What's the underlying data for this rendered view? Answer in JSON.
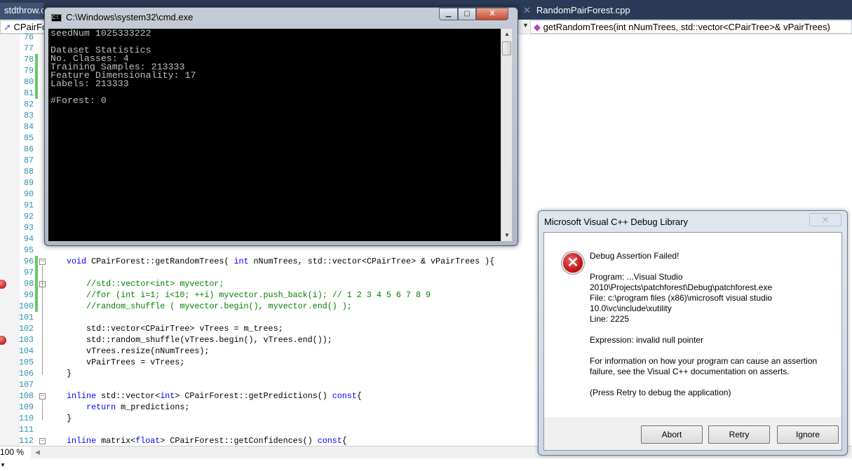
{
  "ide": {
    "tabs": [
      {
        "label": "stdthrow.cpp"
      },
      {
        "label": "RandomPairForest.cpp"
      }
    ],
    "nav_left": "CPairForest",
    "nav_right": "getRandomTrees(int nNumTrees, std::vector<CPairTree>& vPairTrees)",
    "zoom": "100 %",
    "breakpoint_lines": [
      98,
      103
    ],
    "changed_lines": [
      78,
      79,
      80,
      81,
      96,
      97,
      98,
      99,
      100
    ],
    "fold_lines": [
      96,
      98,
      108,
      112
    ],
    "lines": [
      {
        "n": "76",
        "s": []
      },
      {
        "n": "77",
        "s": []
      },
      {
        "n": "78",
        "s": []
      },
      {
        "n": "79",
        "s": []
      },
      {
        "n": "80",
        "s": []
      },
      {
        "n": "81",
        "s": []
      },
      {
        "n": "82",
        "s": []
      },
      {
        "n": "83",
        "s": []
      },
      {
        "n": "84",
        "s": []
      },
      {
        "n": "85",
        "s": []
      },
      {
        "n": "86",
        "s": []
      },
      {
        "n": "87",
        "s": []
      },
      {
        "n": "88",
        "s": []
      },
      {
        "n": "89",
        "s": []
      },
      {
        "n": "90",
        "s": []
      },
      {
        "n": "91",
        "s": []
      },
      {
        "n": "92",
        "s": []
      },
      {
        "n": "93",
        "s": []
      },
      {
        "n": "94",
        "s": []
      },
      {
        "n": "95",
        "s": []
      },
      {
        "n": "96",
        "s": [
          {
            "c": "kw",
            "t": "void"
          },
          {
            "c": "",
            "t": " CPairForest::getRandomTrees( "
          },
          {
            "c": "kw",
            "t": "int"
          },
          {
            "c": "",
            "t": " nNumTrees, std::vector<CPairTree> & vPairTrees ){"
          }
        ]
      },
      {
        "n": "97",
        "s": []
      },
      {
        "n": "98",
        "s": [
          {
            "c": "cm",
            "t": "    //std::vector<int> myvector;"
          }
        ]
      },
      {
        "n": "99",
        "s": [
          {
            "c": "cm",
            "t": "    //for (int i=1; i<10; ++i) myvector.push_back(i); // 1 2 3 4 5 6 7 8 9"
          }
        ]
      },
      {
        "n": "100",
        "s": [
          {
            "c": "cm",
            "t": "    //random_shuffle ( myvector.begin(), myvector.end() );"
          }
        ]
      },
      {
        "n": "101",
        "s": []
      },
      {
        "n": "102",
        "s": [
          {
            "c": "",
            "t": "    std::vector<CPairTree> vTrees = m_trees;"
          }
        ]
      },
      {
        "n": "103",
        "s": [
          {
            "c": "",
            "t": "    std::random_shuffle(vTrees.begin(), vTrees.end());"
          }
        ]
      },
      {
        "n": "104",
        "s": [
          {
            "c": "",
            "t": "    vTrees.resize(nNumTrees);"
          }
        ]
      },
      {
        "n": "105",
        "s": [
          {
            "c": "",
            "t": "    vPairTrees = vTrees;"
          }
        ]
      },
      {
        "n": "106",
        "s": [
          {
            "c": "",
            "t": "}"
          }
        ]
      },
      {
        "n": "107",
        "s": []
      },
      {
        "n": "108",
        "s": [
          {
            "c": "kw",
            "t": "inline"
          },
          {
            "c": "",
            "t": " std::vector<"
          },
          {
            "c": "kw",
            "t": "int"
          },
          {
            "c": "",
            "t": "> CPairForest::getPredictions() "
          },
          {
            "c": "kw",
            "t": "const"
          },
          {
            "c": "",
            "t": "{"
          }
        ]
      },
      {
        "n": "109",
        "s": [
          {
            "c": "",
            "t": "    "
          },
          {
            "c": "kw",
            "t": "return"
          },
          {
            "c": "",
            "t": " m_predictions;"
          }
        ]
      },
      {
        "n": "110",
        "s": [
          {
            "c": "",
            "t": "}"
          }
        ]
      },
      {
        "n": "111",
        "s": []
      },
      {
        "n": "112",
        "s": [
          {
            "c": "kw",
            "t": "inline"
          },
          {
            "c": "",
            "t": " matrix<"
          },
          {
            "c": "kw",
            "t": "float"
          },
          {
            "c": "",
            "t": "> CPairForest::getConfidences() "
          },
          {
            "c": "kw",
            "t": "const"
          },
          {
            "c": "",
            "t": "{"
          }
        ]
      }
    ]
  },
  "cmd": {
    "title": "C:\\Windows\\system32\\cmd.exe",
    "icon_label": "C:\\",
    "output": "seedNum 1025333222\n\nDataset Statistics\nNo. Classes: 4\nTraining Samples: 213333\nFeature Dimensionality: 17\nLabels: 213333\n\n#Forest: 0"
  },
  "dialog": {
    "title": "Microsoft Visual C++ Debug Library",
    "heading": "Debug Assertion Failed!",
    "program": "Program: ...Visual Studio 2010\\Projects\\patchforest\\Debug\\patchforest.exe",
    "file": "File: c:\\program files (x86)\\microsoft visual studio 10.0\\vc\\include\\xutility",
    "line": "Line: 2225",
    "expression": "Expression: invalid null pointer",
    "info": "For information on how your program can cause an assertion failure, see the Visual C++ documentation on asserts.",
    "hint": "(Press Retry to debug the application)",
    "buttons": {
      "abort": "Abort",
      "retry": "Retry",
      "ignore": "Ignore"
    }
  }
}
